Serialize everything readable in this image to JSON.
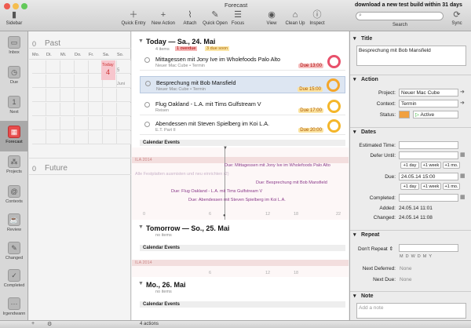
{
  "window": {
    "title": "Forecast",
    "message": "download a new test build within 31 days"
  },
  "toolbar": {
    "sidebar": "Sidebar",
    "quick_entry": "Quick Entry",
    "new_action": "New Action",
    "attach": "Attach",
    "quick_open": "Quick Open",
    "focus": "Focus",
    "view": "View",
    "clean_up": "Clean Up",
    "inspect": "Inspect",
    "search": "Search",
    "sync": "Sync",
    "search_placeholder": ""
  },
  "sidebar": {
    "items": [
      {
        "label": "Inbox"
      },
      {
        "label": "Due"
      },
      {
        "label": "Next"
      },
      {
        "label": "Forecast"
      },
      {
        "label": "Projects"
      },
      {
        "label": "Contexts"
      },
      {
        "label": "Review"
      },
      {
        "label": "Changed"
      },
      {
        "label": "Completed"
      },
      {
        "label": "Irgendwann"
      }
    ]
  },
  "calendar": {
    "past": "Past",
    "future": "Future",
    "past_num": "0",
    "future_num": "0",
    "weekdays": [
      "Mo.",
      "Di.",
      "Mi.",
      "Do.",
      "Fr.",
      "Sa.",
      "So."
    ],
    "today_label": "Today",
    "today_num": "4",
    "extra_month": "Juni",
    "next_num": "5"
  },
  "main": {
    "today": {
      "title": "Today — Sa., 24. Mai",
      "items": "4 items",
      "overdue": "1 overdue",
      "due_soon": "3 due soon"
    },
    "tasks": [
      {
        "title": "Mittagessen mit Jony Ive im Wholefoods Palo Alto",
        "ctx": "Neuer Mac Cube • Termin",
        "due": "Due 13:00"
      },
      {
        "title": "Besprechung mit Bob Mansfield",
        "ctx": "Neuer Mac Cube • Termin",
        "due": "Due 15:00"
      },
      {
        "title": "Flug Oakland - L.A. mit Tims Gulfstream V",
        "ctx": "Reisen",
        "due": "Due 17:00"
      },
      {
        "title": "Abendessen mit Steven Spielberg im Koi L.A.",
        "ctx": "E.T. Part II",
        "due": "Due 20:00"
      }
    ],
    "calendar_events": "Calendar Events",
    "tl_label": "ILA 2014",
    "tl_items": [
      "Due: Mittagessen mit Jony Ive im Wholefoods Palo Alto",
      "Alle Festplatten ausmisten und neu einrichten (2)",
      "Due: Besprechung mit Bob Mansfield",
      "Due: Flug Oakland - L.A. mit Tims Gulfstream V",
      "Due: Abendessen mit Steven Spielberg im Koi L.A."
    ],
    "tl_ticks": [
      "0",
      "6",
      "12",
      "18",
      "22"
    ],
    "tomorrow": {
      "title": "Tomorrow — So., 25. Mai",
      "sub": "no items"
    },
    "monday": {
      "title": "Mo., 26. Mai",
      "sub": "no items"
    }
  },
  "inspector": {
    "title_hdr": "Title",
    "title_val": "Besprechung mit Bob Mansfield",
    "action_hdr": "Action",
    "project_l": "Project:",
    "project_v": "Neuer Mac Cube",
    "context_l": "Context:",
    "context_v": "Termin",
    "status_l": "Status:",
    "status_v": "Active",
    "dates_hdr": "Dates",
    "est_l": "Estimated Time:",
    "defer_l": "Defer Until:",
    "due_l": "Due:",
    "due_v": "24.05.14 15:00",
    "completed_l": "Completed:",
    "added_l": "Added:",
    "added_v": "24.05.14 11:01",
    "changed_l": "Changed:",
    "changed_v": "24.05.14 11:08",
    "plus_day": "+1 day",
    "plus_week": "+1 week",
    "plus_month": "+1 mo.",
    "repeat_hdr": "Repeat",
    "dont_repeat": "Don't Repeat",
    "rep_units": [
      "M",
      "D",
      "W",
      "D",
      "M",
      "Y"
    ],
    "next_deferred_l": "Next Deferred:",
    "next_deferred_v": "None",
    "next_due_l": "Next Due:",
    "next_due_v": "None",
    "note_hdr": "Note",
    "note_placeholder": "Add a note"
  },
  "status": {
    "count": "4 actions"
  }
}
